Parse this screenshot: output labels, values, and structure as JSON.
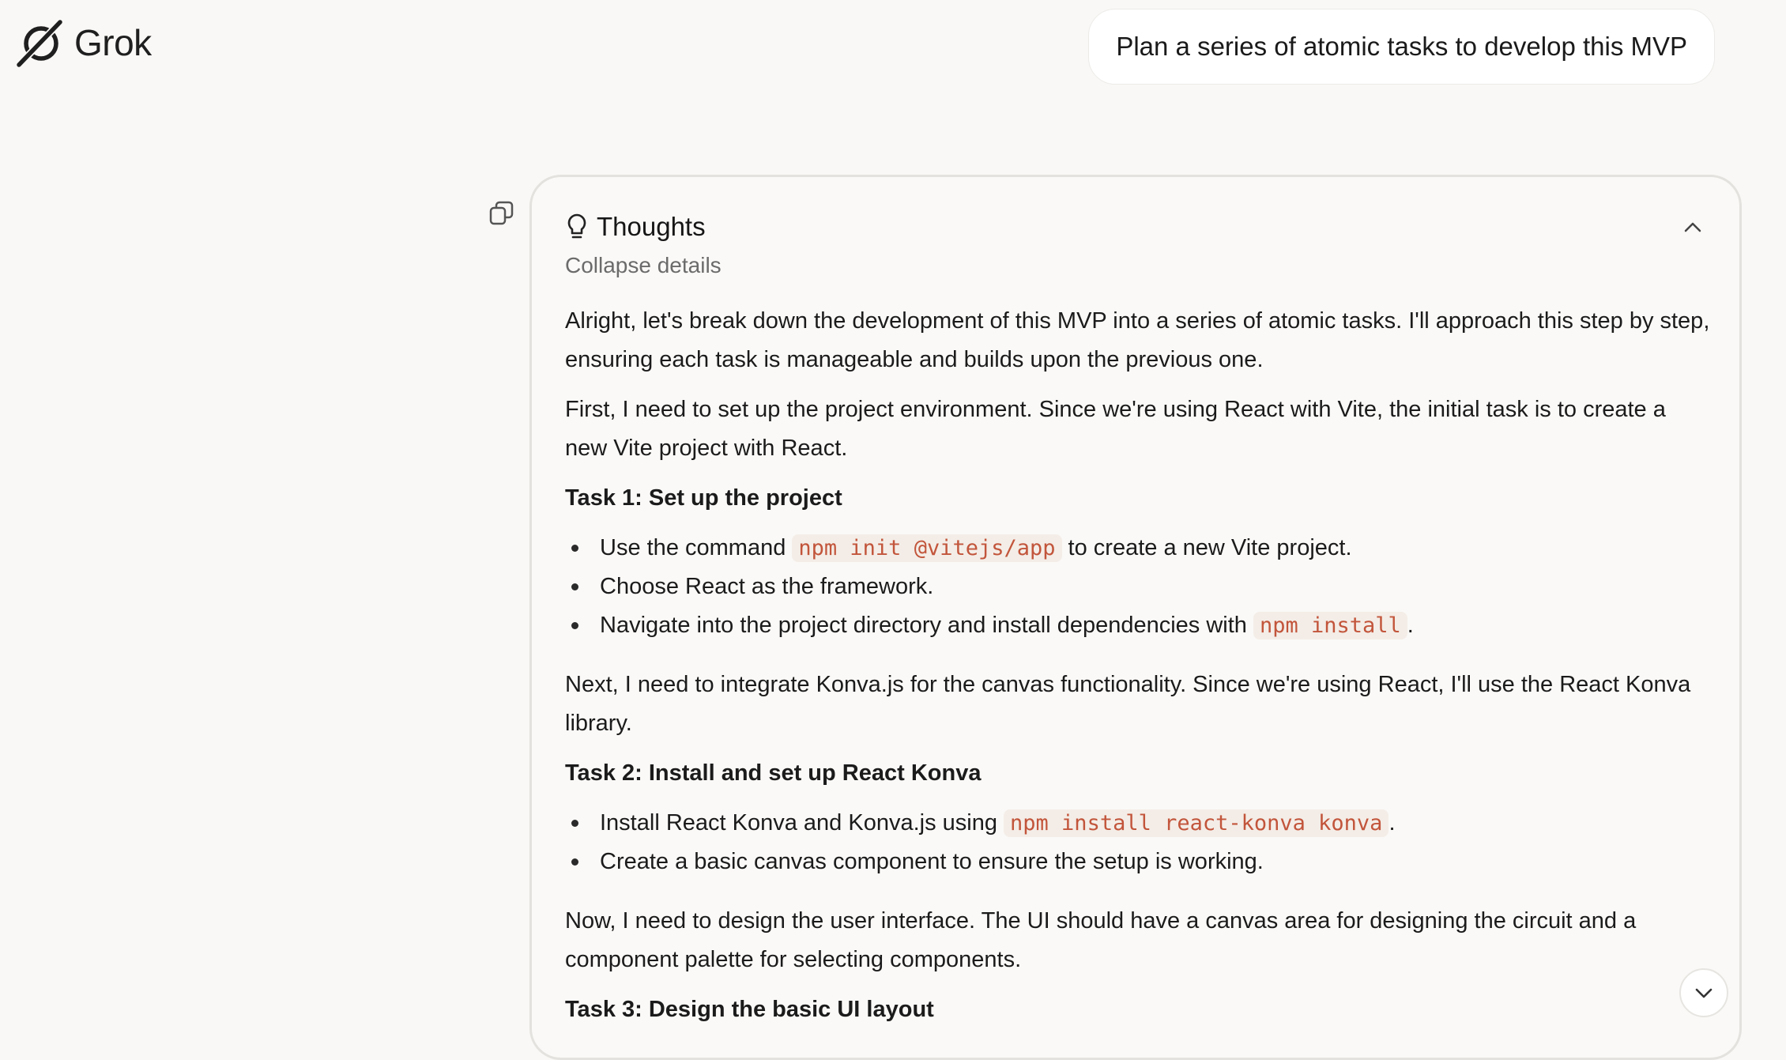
{
  "header": {
    "logo_text": "Grok",
    "logo_icon": "grok-logo-icon"
  },
  "user_message": "Plan a series of atomic tasks to develop this MVP",
  "thoughts": {
    "title": "Thoughts",
    "toggle_label": "Collapse details",
    "content": {
      "p1": "Alright, let's break down the development of this MVP into a series of atomic tasks. I'll approach this step by step, ensuring each task is manageable and builds upon the previous one.",
      "p2": "First, I need to set up the project environment. Since we're using React with Vite, the initial task is to create a new Vite project with React.",
      "task1": {
        "heading": "Task 1: Set up the project",
        "item1_pre": "Use the command ",
        "item1_code": "npm init @vitejs/app",
        "item1_post": " to create a new Vite project.",
        "item2": "Choose React as the framework.",
        "item3_pre": "Navigate into the project directory and install dependencies with ",
        "item3_code": "npm install",
        "item3_post": "."
      },
      "p3": "Next, I need to integrate Konva.js for the canvas functionality. Since we're using React, I'll use the React Konva library.",
      "task2": {
        "heading": "Task 2: Install and set up React Konva",
        "item1_pre": "Install React Konva and Konva.js using ",
        "item1_code": "npm install react-konva konva",
        "item1_post": ".",
        "item2": "Create a basic canvas component to ensure the setup is working."
      },
      "p4": "Now, I need to design the user interface. The UI should have a canvas area for designing the circuit and a component palette for selecting components.",
      "task3": {
        "heading": "Task 3: Design the basic UI layout"
      }
    }
  },
  "colors": {
    "background": "#f9f8f6",
    "code_text": "#c2553b",
    "code_bg": "#f4ede7"
  }
}
